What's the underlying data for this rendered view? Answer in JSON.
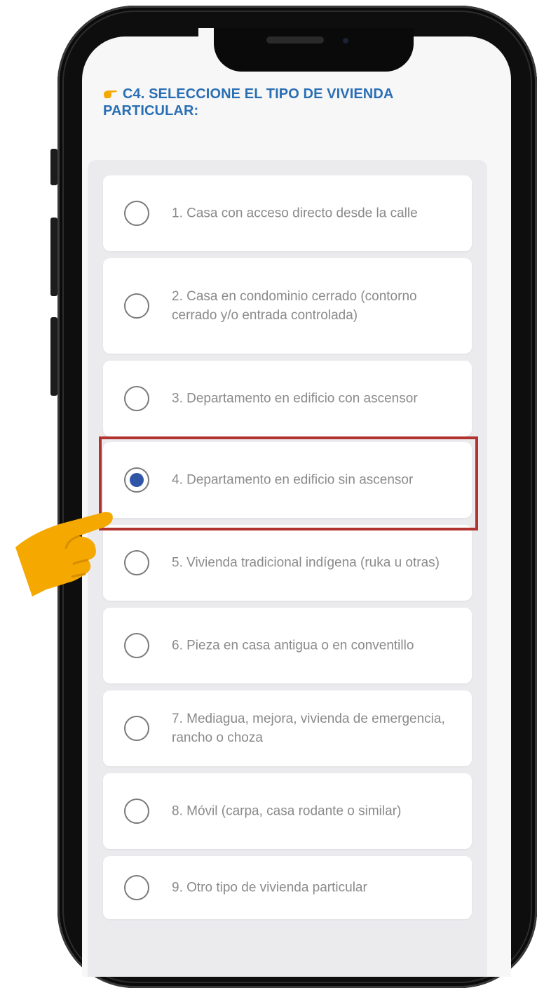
{
  "question": {
    "icon": "pointing-hand-icon",
    "text": "C4. SELECCIONE EL TIPO DE VIVIENDA PARTICULAR:",
    "color": "#2a6fb4"
  },
  "options": [
    {
      "label": "1. Casa con acceso directo desde la calle",
      "selected": false
    },
    {
      "label": "2. Casa en condominio cerrado (contorno cerrado y/o entrada controlada)",
      "selected": false
    },
    {
      "label": "3. Departamento en edificio con ascensor",
      "selected": false
    },
    {
      "label": "4. Departamento en edificio sin ascensor",
      "selected": true
    },
    {
      "label": "5. Vivienda tradicional indígena (ruka u otras)",
      "selected": false
    },
    {
      "label": "6. Pieza en casa antigua o en conventillo",
      "selected": false
    },
    {
      "label": "7. Mediagua, mejora, vivienda de emergencia, rancho o choza",
      "selected": false
    },
    {
      "label": "8. Móvil (carpa, casa rodante o similar)",
      "selected": false
    },
    {
      "label": "9. Otro tipo de vivienda particular",
      "selected": false
    }
  ],
  "colors": {
    "accent": "#2f56a6",
    "highlight_frame": "#b1322f",
    "pointer_hand": "#f5a800",
    "option_text": "#8a8a8a"
  }
}
